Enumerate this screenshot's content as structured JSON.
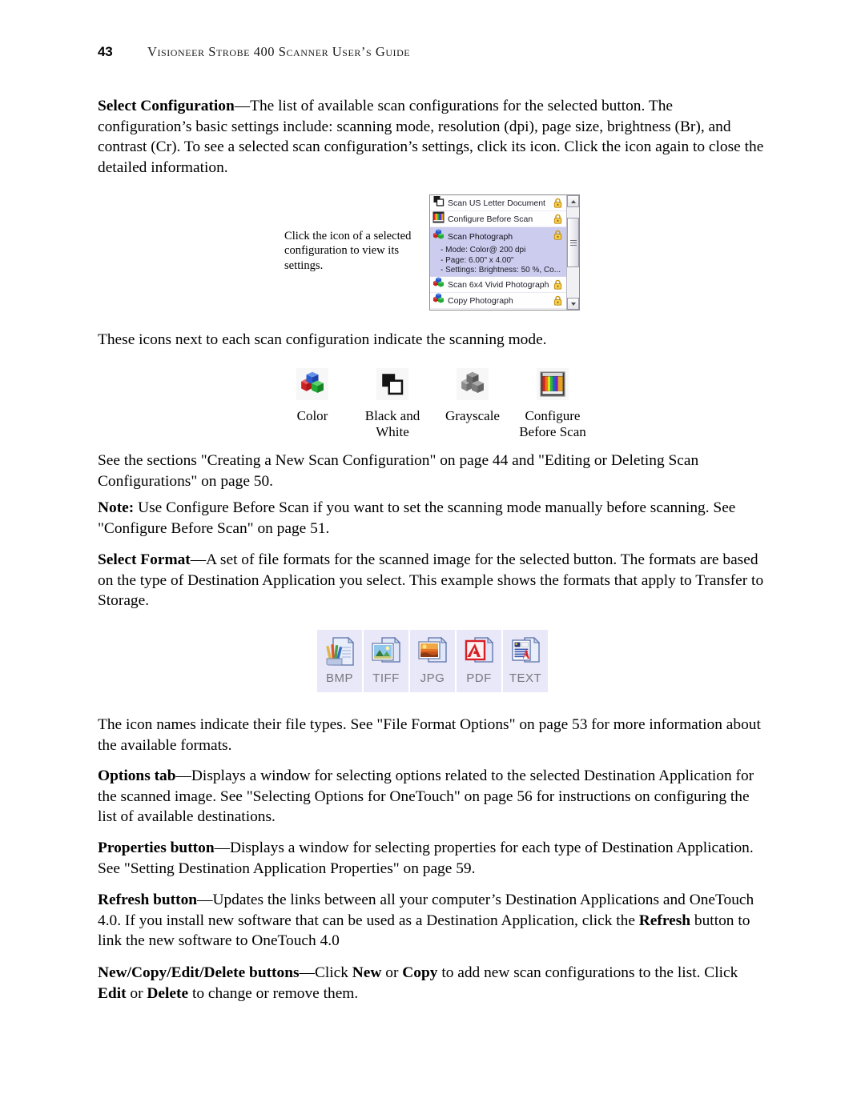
{
  "header": {
    "folio": "43",
    "title": "Visioneer Strobe 400 Scanner User’s Guide"
  },
  "sections": {
    "select_configuration": {
      "lead": "Select Configuration",
      "body": "—The list of available scan configurations for the selected button. The configuration’s basic settings include: scanning mode, resolution (dpi), page size, brightness (Br), and contrast (Cr). To see a selected scan configuration’s settings, click its icon. Click the icon again to close the detailed information."
    },
    "icons_intro": "These icons next to each scan configuration indicate the scanning mode.",
    "see_sections": "See the sections \"Creating a New Scan Configuration\" on page 44 and \"Editing or Deleting Scan Configurations\" on page 50.",
    "note": {
      "lead": "Note:",
      "body": " Use Configure Before Scan if you want to set the scanning mode manually before scanning. See \"Configure Before Scan\" on page 51."
    },
    "select_format": {
      "lead": "Select Format",
      "body": "—A set of file formats for the scanned image for the selected button. The formats are based on the type of Destination Application you select. This example shows the formats that apply to Transfer to Storage."
    },
    "icon_names": "The icon names indicate their file types. See \"File Format Options\" on page 53 for more information about the available formats.",
    "options_tab": {
      "lead": "Options tab",
      "body": "—Displays a window for selecting options related to the selected Destination Application for the scanned image. See \"Selecting Options for OneTouch\" on page 56 for instructions on configuring the list of available destinations."
    },
    "properties_button": {
      "lead": "Properties button",
      "body": "—Displays a window for selecting properties for each type of Destination Application. See \"Setting Destination Application Properties\" on page 59."
    },
    "refresh_button": {
      "lead": "Refresh button",
      "body_1": "—Updates the links between all your computer’s Destination Applications and OneTouch 4.0. If you install new software that can be used as a Destination Application, click the ",
      "emphasis_1": "Refresh",
      "body_2": " button to link the new software to OneTouch 4.0"
    },
    "new_copy_edit_delete": {
      "lead": "New/Copy/Edit/Delete buttons",
      "body_1": "—Click ",
      "emphasis_1": "New",
      "body_2": " or ",
      "emphasis_2": "Copy",
      "body_3": " to add new scan configurations to the list. Click ",
      "emphasis_3": "Edit",
      "body_4": " or ",
      "emphasis_4": "Delete",
      "body_5": " to change or remove them."
    }
  },
  "config_figure": {
    "callout": "Click the icon of a selected configuration to view its settings.",
    "rows": [
      {
        "label": "Scan US Letter Document",
        "mode_icon": "black-and-white-mode-icon",
        "locked": true,
        "selected": false
      },
      {
        "label": "Configure Before Scan",
        "mode_icon": "configure-before-scan-mode-icon",
        "locked": true,
        "selected": false
      },
      {
        "label": "Scan Photograph",
        "mode_icon": "color-mode-icon",
        "locked": true,
        "selected": true,
        "details": [
          "- Mode: Color@ 200 dpi",
          "- Page:  6.00\" x  4.00\"",
          "- Settings: Brightness: 50 %, Co..."
        ]
      },
      {
        "label": "Scan 6x4 Vivid Photograph",
        "mode_icon": "color-mode-icon",
        "locked": true,
        "selected": false
      },
      {
        "label": "Copy Photograph",
        "mode_icon": "color-mode-icon",
        "locked": true,
        "selected": false
      }
    ],
    "scrollbar": {
      "up_arrow": "scroll-up-arrow",
      "down_arrow": "scroll-down-arrow"
    },
    "colors": {
      "selected_row": "#ccccee",
      "list_background": "#fefeff",
      "lock": "#e8b830"
    }
  },
  "mode_icons": [
    {
      "label": "Color",
      "icon": "color-cubes-icon"
    },
    {
      "label": "Black and White",
      "icon": "black-white-squares-icon"
    },
    {
      "label": "Grayscale",
      "icon": "gray-cubes-icon"
    },
    {
      "label": "Configure Before Scan",
      "icon": "color-bars-icon"
    }
  ],
  "format_icons": [
    {
      "label": "BMP",
      "icon": "bmp-file-icon"
    },
    {
      "label": "TIFF",
      "icon": "tiff-file-icon"
    },
    {
      "label": "JPG",
      "icon": "jpg-file-icon"
    },
    {
      "label": "PDF",
      "icon": "pdf-file-icon"
    },
    {
      "label": "TEXT",
      "icon": "text-file-icon"
    }
  ]
}
